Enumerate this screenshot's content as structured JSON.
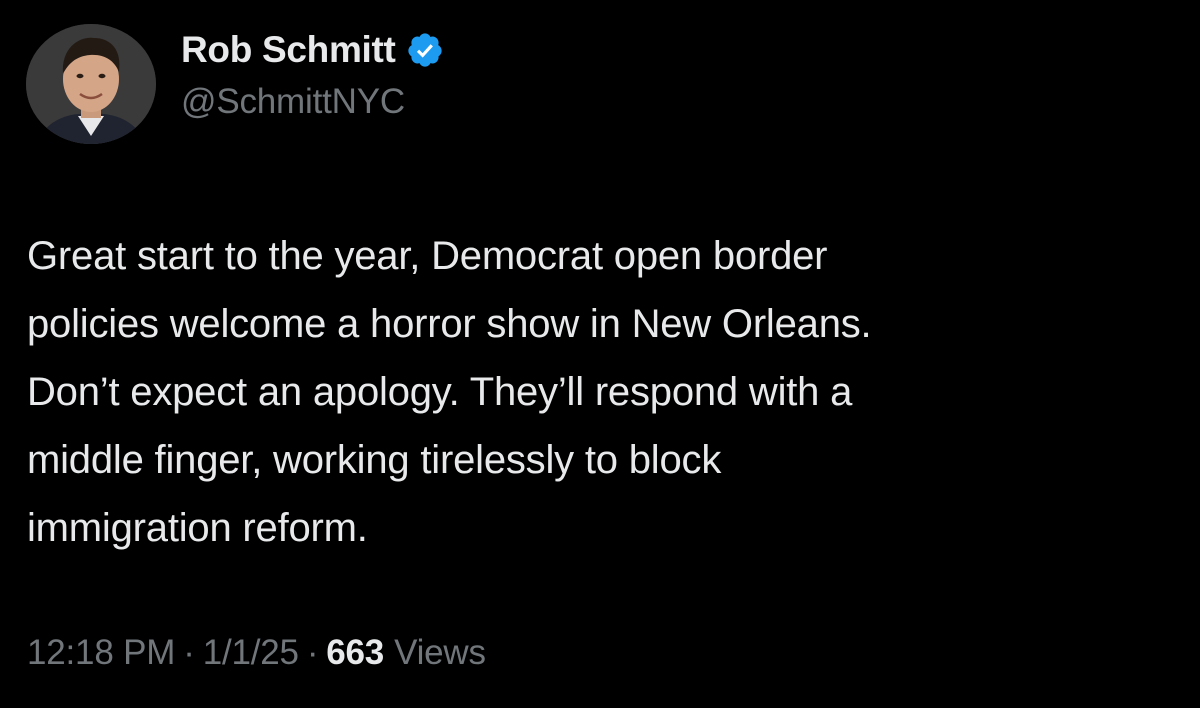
{
  "author": {
    "display_name": "Rob Schmitt",
    "handle": "@SchmittNYC",
    "verified_icon": "verified-badge-icon",
    "verified_color": "#1d9bf0"
  },
  "tweet": {
    "text": "Great start to the year, Democrat open border\npolicies welcome a horror show in New Orleans.\nDon’t expect an apology. They’ll respond with a\nmiddle finger, working tirelessly to block\nimmigration reform."
  },
  "meta": {
    "time": "12:18 PM",
    "separator": "·",
    "date": "1/1/25",
    "views_count": "663",
    "views_label": "Views"
  },
  "colors": {
    "background": "#000000",
    "primary_text": "#e7e9ea",
    "secondary_text": "#71767b"
  }
}
